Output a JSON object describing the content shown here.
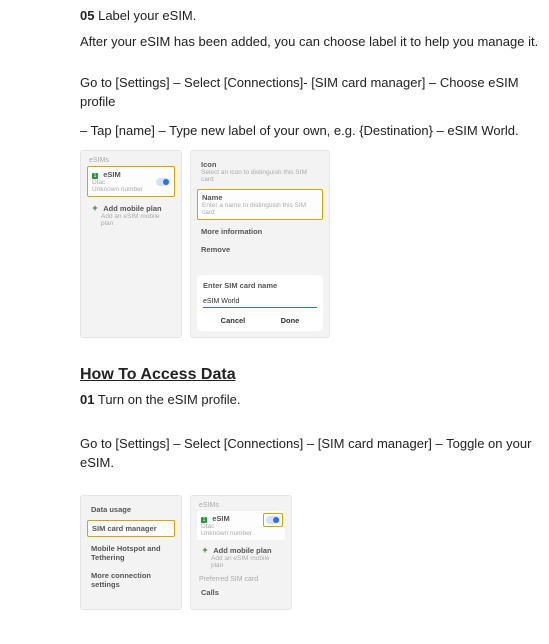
{
  "step05": {
    "num": "05",
    "title": "Label your eSIM."
  },
  "para_after": "After your eSIM has been added, you can choose label it to help you manage it.",
  "para_goto1": "Go to [Settings] – Select [Connections]- [SIM card manager] – Choose eSIM profile",
  "para_tap": "– Tap [name] – Type new label of your own, e.g. {Destination} – eSIM World.",
  "mock1": {
    "left_header": "eSIMs",
    "esim_label": "eSIM",
    "esim_sub1": "Dtac",
    "esim_sub2": "Unknown number",
    "add_label": "Add mobile plan",
    "add_sub": "Add an eSIM mobile plan",
    "right": {
      "icon_label": "Icon",
      "icon_sub": "Select an icon to distinguish this SIM card",
      "name_label": "Name",
      "name_sub": "Enter a name to distinguish this SIM card",
      "more": "More information",
      "remove": "Remove",
      "dialog_title": "Enter SIM card name",
      "dialog_value": "eSIM World",
      "btn_cancel": "Cancel",
      "btn_done": "Done"
    }
  },
  "section2": "How To Access Data",
  "step01": {
    "num": "01",
    "title": "Turn on the eSIM profile."
  },
  "para_goto2": "Go to [Settings] – Select [Connections] – [SIM card manager] – Toggle on your eSIM.",
  "mock2": {
    "left": {
      "r1": "Data usage",
      "r2": "SIM card manager",
      "r3": "Mobile Hotspot and Tethering",
      "r4": "More connection settings"
    },
    "right": {
      "header": "eSIMs",
      "esim_label": "eSIM",
      "esim_sub1": "Dtac",
      "esim_sub2": "Unknown number",
      "add_label": "Add mobile plan",
      "add_sub": "Add an eSIM mobile plan",
      "pref": "Preferred SIM card",
      "calls": "Calls"
    }
  }
}
